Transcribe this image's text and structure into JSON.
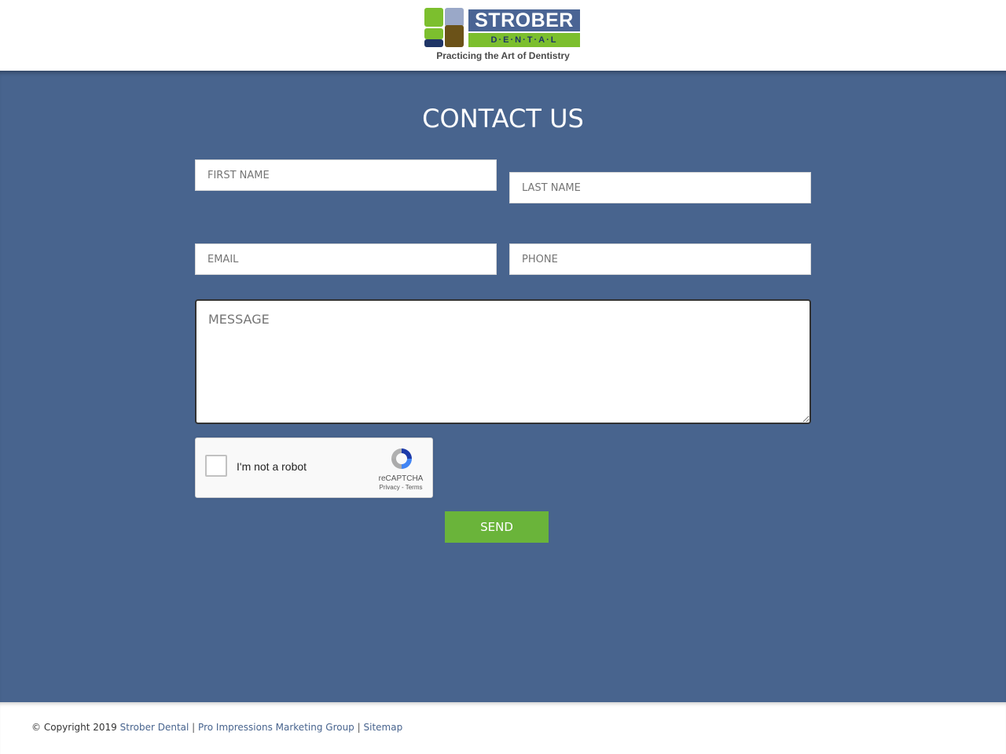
{
  "header": {
    "logo": {
      "name": "STROBER",
      "sub": "D·E·N·T·A·L",
      "tagline": "Practicing the Art of Dentistry"
    }
  },
  "main": {
    "title": "CONTACT US",
    "fields": {
      "first_name": "FIRST NAME",
      "last_name": "LAST NAME",
      "email": "EMAIL",
      "phone": "PHONE",
      "message": "MESSAGE"
    },
    "captcha": {
      "label": "I'm not a robot",
      "brand": "reCAPTCHA",
      "links": "Privacy - Terms"
    },
    "send_label": "SEND"
  },
  "footer": {
    "copyright": "© Copyright 2019",
    "link1": "Strober Dental",
    "link2": "Pro Impressions Marketing Group",
    "link3": "Sitemap",
    "separator": "|"
  },
  "colors": {
    "brand_blue": "#48648e",
    "brand_green": "#6ab43a"
  }
}
